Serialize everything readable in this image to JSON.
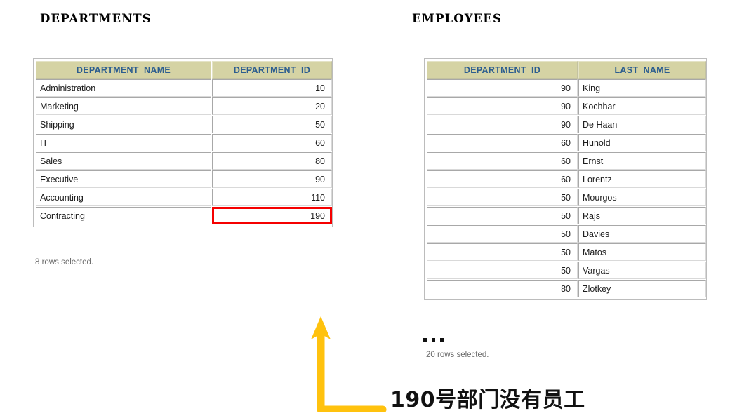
{
  "colors": {
    "header_bg": "#d5d3a4",
    "header_text": "#2c5d8f",
    "highlight_border": "#f50000",
    "arrow": "#ffc20e",
    "grid_border": "#bcbcbc"
  },
  "departments": {
    "title": "DEPARTMENTS",
    "columns": [
      "DEPARTMENT_NAME",
      "DEPARTMENT_ID"
    ],
    "rows": [
      {
        "name": "Administration",
        "id": "10",
        "highlight": false
      },
      {
        "name": "Marketing",
        "id": "20",
        "highlight": false
      },
      {
        "name": "Shipping",
        "id": "50",
        "highlight": false
      },
      {
        "name": "IT",
        "id": "60",
        "highlight": false
      },
      {
        "name": "Sales",
        "id": "80",
        "highlight": false
      },
      {
        "name": "Executive",
        "id": "90",
        "highlight": false
      },
      {
        "name": "Accounting",
        "id": "110",
        "highlight": false
      },
      {
        "name": "Contracting",
        "id": "190",
        "highlight": true
      }
    ],
    "rows_note": "8 rows selected."
  },
  "employees": {
    "title": "EMPLOYEES",
    "columns": [
      "DEPARTMENT_ID",
      "LAST_NAME"
    ],
    "rows": [
      {
        "id": "90",
        "last_name": "King"
      },
      {
        "id": "90",
        "last_name": "Kochhar"
      },
      {
        "id": "90",
        "last_name": "De Haan"
      },
      {
        "id": "60",
        "last_name": "Hunold"
      },
      {
        "id": "60",
        "last_name": "Ernst"
      },
      {
        "id": "60",
        "last_name": "Lorentz"
      },
      {
        "id": "50",
        "last_name": "Mourgos"
      },
      {
        "id": "50",
        "last_name": "Rajs"
      },
      {
        "id": "50",
        "last_name": "Davies"
      },
      {
        "id": "50",
        "last_name": "Matos"
      },
      {
        "id": "50",
        "last_name": "Vargas"
      },
      {
        "id": "80",
        "last_name": "Zlotkey"
      }
    ],
    "truncation_marker": "...",
    "rows_note": "20 rows selected."
  },
  "annotation": {
    "text": "190号部门没有员工",
    "arrow": "elbow-up-arrow"
  }
}
